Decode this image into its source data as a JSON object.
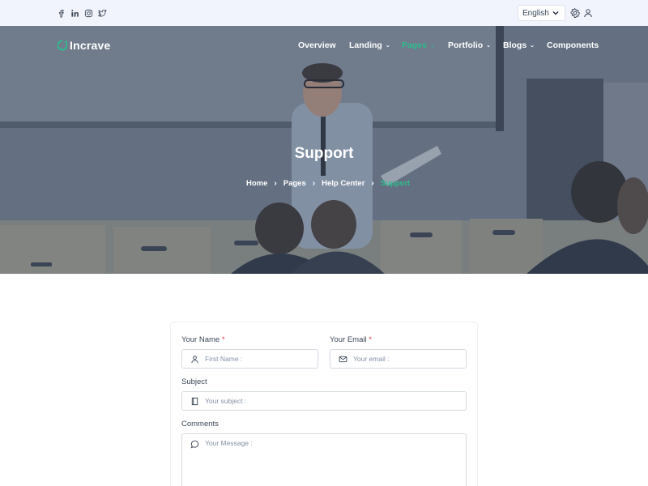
{
  "topbar": {
    "social": [
      {
        "icon": "facebook-icon"
      },
      {
        "icon": "linkedin-icon"
      },
      {
        "icon": "instagram-icon"
      },
      {
        "icon": "twitter-icon"
      }
    ],
    "language": "English",
    "icons": [
      "settings-icon",
      "user-icon"
    ]
  },
  "brand": {
    "name": "Incrave",
    "accent": "#2fbb8f"
  },
  "nav": {
    "overview": "Overview",
    "landing": "Landing",
    "pages": "Pages",
    "portfolio": "Portfolio",
    "blogs": "Blogs",
    "components": "Components"
  },
  "hero": {
    "title": "Support",
    "breadcrumb": {
      "home": "Home",
      "pages": "Pages",
      "help_center": "Help Center",
      "current": "Support"
    }
  },
  "form": {
    "name_label": "Your Name",
    "name_placeholder": "First Name :",
    "email_label": "Your Email",
    "email_placeholder": "Your email :",
    "required_mark": "*",
    "subject_label": "Subject",
    "subject_placeholder": "Your subject :",
    "comments_label": "Comments",
    "comments_placeholder": "Your Message :"
  }
}
